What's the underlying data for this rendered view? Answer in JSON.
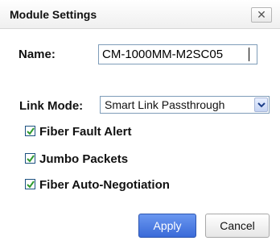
{
  "dialog": {
    "title": "Module Settings",
    "close_label": "✕"
  },
  "form": {
    "name_label": "Name:",
    "name_value": "CM-1000MM-M2SC05",
    "link_mode_label": "Link Mode:",
    "link_mode_value": "Smart Link Passthrough",
    "checkboxes": [
      {
        "label": "Fiber Fault Alert",
        "checked": true
      },
      {
        "label": "Jumbo Packets",
        "checked": true
      },
      {
        "label": "Fiber Auto-Negotiation",
        "checked": true
      }
    ]
  },
  "buttons": {
    "apply": "Apply",
    "cancel": "Cancel"
  },
  "colors": {
    "accent": "#3a6ad8",
    "check": "#2e9a2e"
  },
  "icons": {
    "close": "close-icon",
    "dropdown": "chevron-down-icon",
    "check": "checkmark-icon"
  }
}
